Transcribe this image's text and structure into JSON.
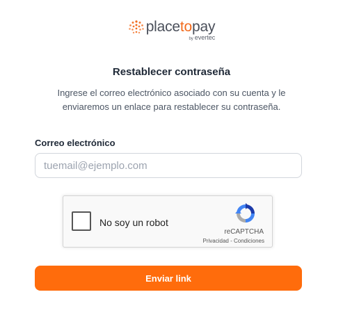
{
  "brand": {
    "name_prefix": "place",
    "name_mid": "to",
    "name_suffix": "pay",
    "by": "by",
    "partner": "evertec",
    "accent_color": "#f26b1d"
  },
  "form": {
    "title": "Restablecer contraseña",
    "description": "Ingrese el correo electrónico asociado con su cuenta y le enviaremos un enlace para restablecer su contraseña.",
    "email_label": "Correo electrónico",
    "email_value": "",
    "email_placeholder": "tuemail@ejemplo.com",
    "submit_label": "Enviar link",
    "submit_color": "#ff6c0c"
  },
  "recaptcha": {
    "checkbox_label": "No soy un robot",
    "checked": false,
    "brand": "reCAPTCHA",
    "privacy_link": "Privacidad",
    "separator": " - ",
    "terms_link": "Condiciones",
    "icon": "recaptcha-logo-icon"
  }
}
